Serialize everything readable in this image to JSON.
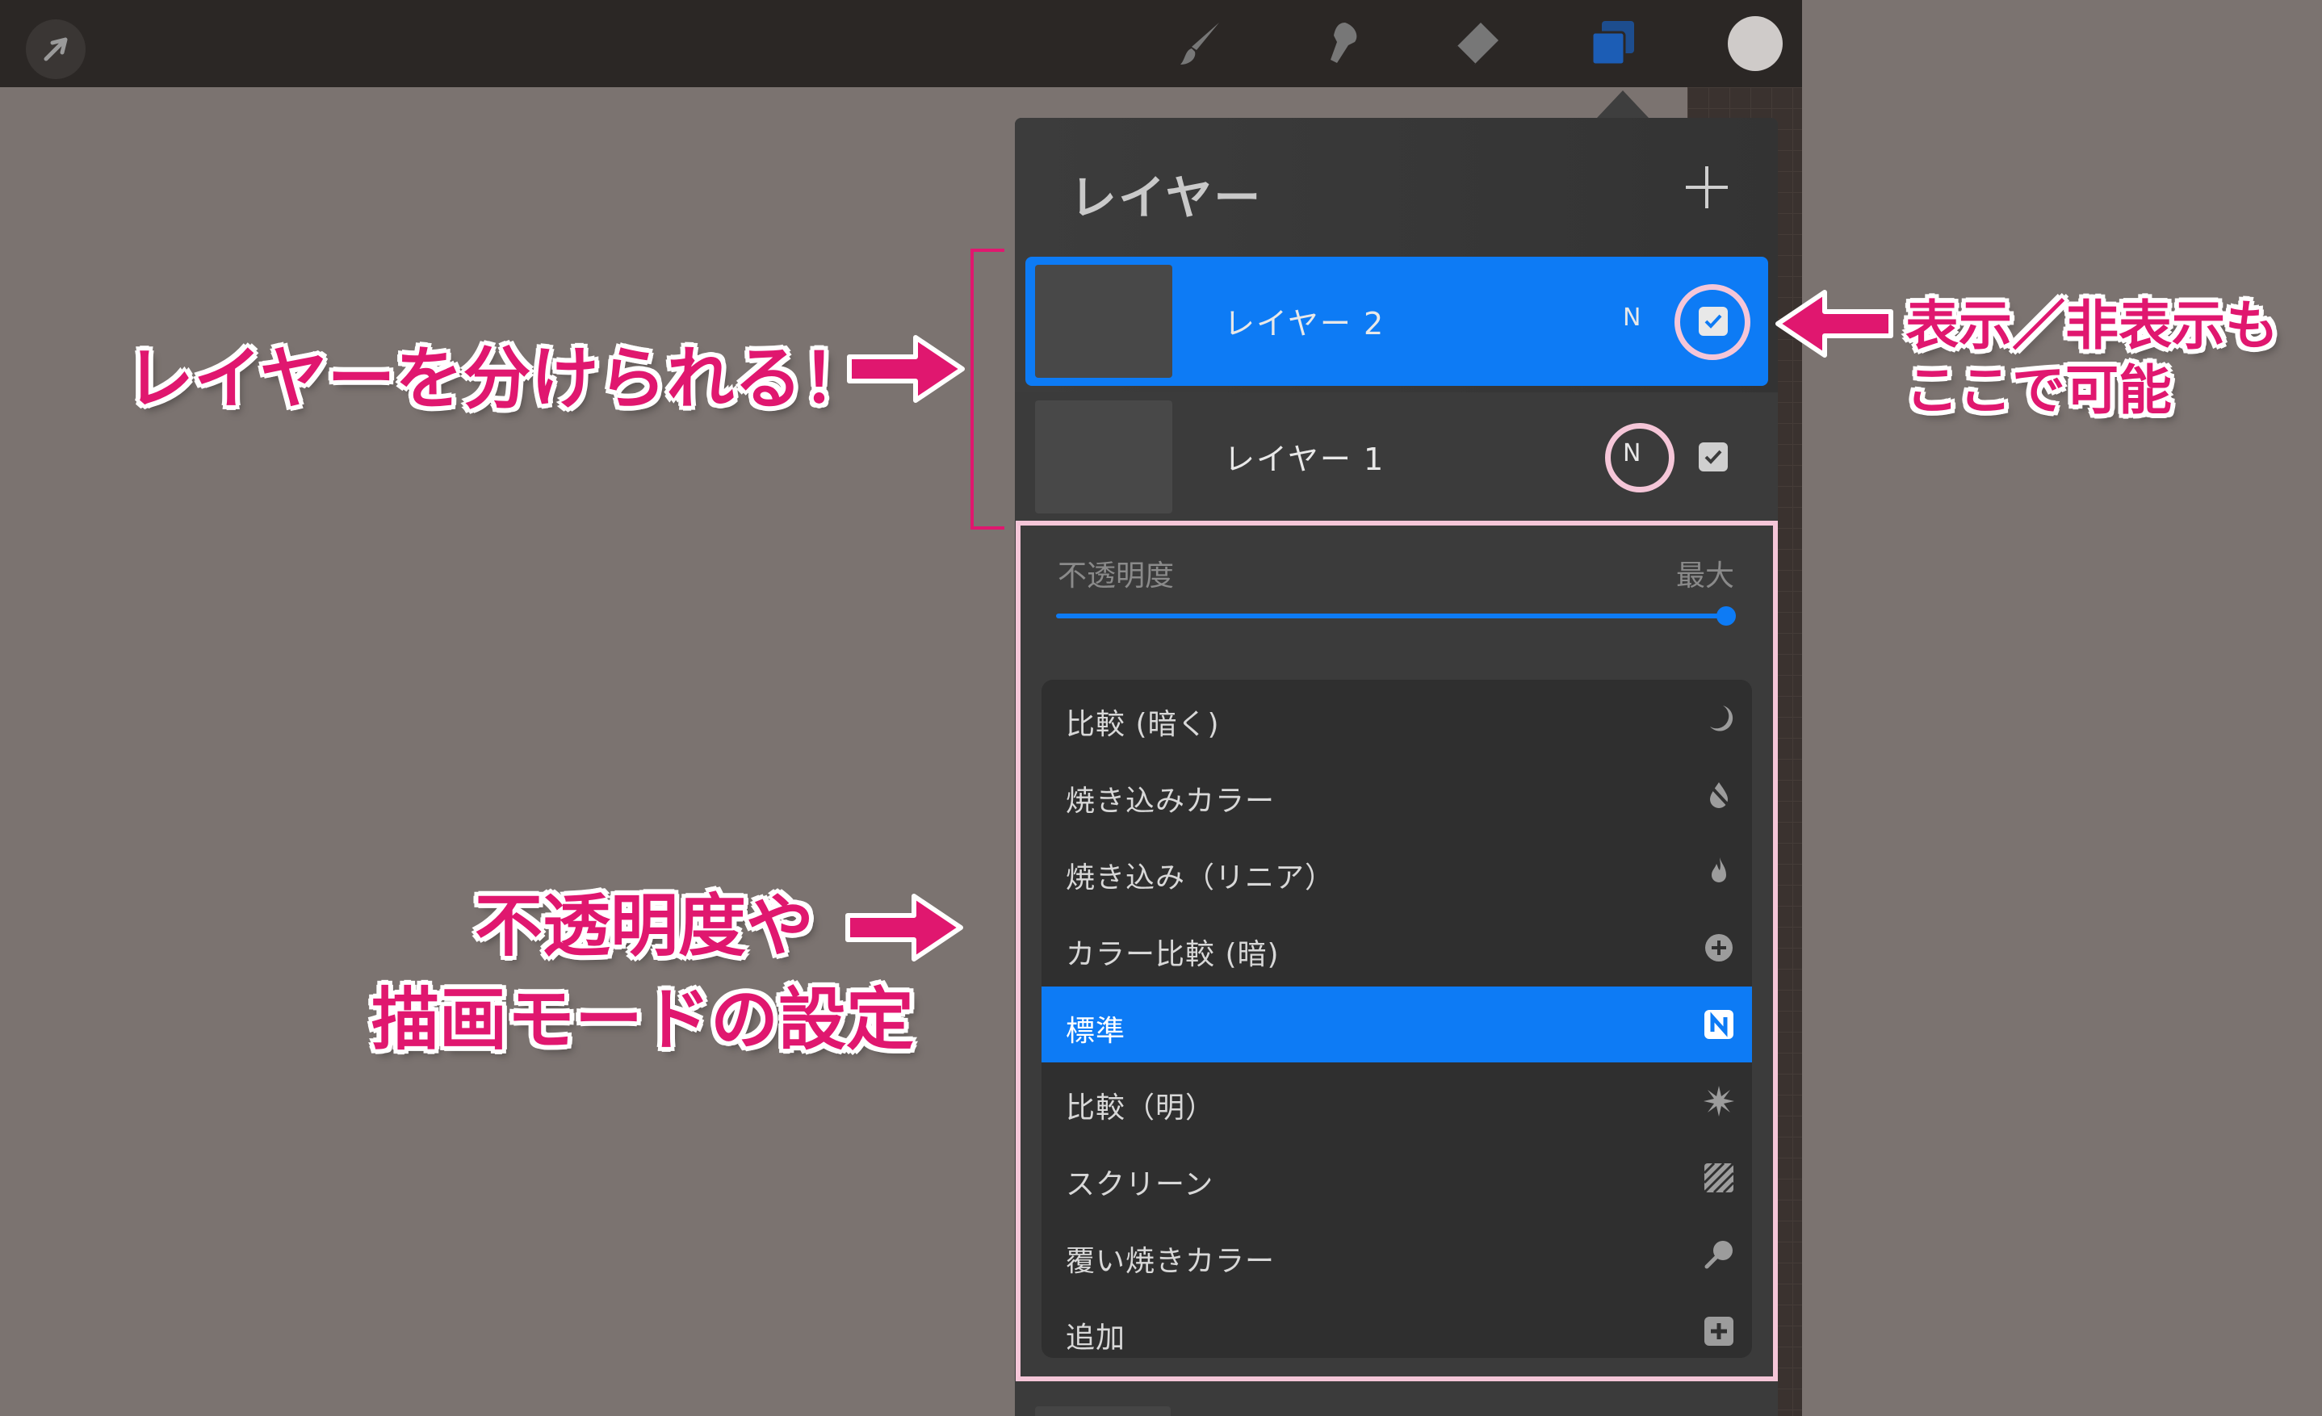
{
  "toolbar": {
    "tools": [
      "actions-icon",
      "brush-icon",
      "smudge-icon",
      "eraser-icon",
      "layers-icon",
      "color-icon"
    ]
  },
  "panel": {
    "title": "レイヤー",
    "layers": [
      {
        "name": "レイヤー 2",
        "blend": "N",
        "visible": true,
        "active": true
      },
      {
        "name": "レイヤー 1",
        "blend": "N",
        "visible": true,
        "active": false
      }
    ],
    "opacity_label": "不透明度",
    "opacity_value": "最大",
    "opacity_fraction": 1.0,
    "blend_modes": [
      {
        "label": "比較 (暗く)",
        "icon": "moon-icon"
      },
      {
        "label": "焼き込みカラー",
        "icon": "burn-drop-icon"
      },
      {
        "label": "焼き込み（リニア）",
        "icon": "flame-icon"
      },
      {
        "label": "カラー比較 (暗)",
        "icon": "plus-circle-icon"
      },
      {
        "label": "標準",
        "icon": "n-badge-icon",
        "selected": true
      },
      {
        "label": "比較（明）",
        "icon": "sunburst-icon"
      },
      {
        "label": "スクリーン",
        "icon": "hatch-icon"
      },
      {
        "label": "覆い焼きカラー",
        "icon": "dodge-icon"
      },
      {
        "label": "追加",
        "icon": "plus-square-icon"
      }
    ]
  },
  "annotations": {
    "layers_note": "レイヤーを分けられる！",
    "visibility_note_1": "表示／非表示も",
    "visibility_note_2": "ここで可能",
    "blend_note_1": "不透明度や",
    "blend_note_2": "描画モードの設定"
  },
  "colors": {
    "accent": "#0d7bf5",
    "annotation": "#e0176f",
    "highlight_ring": "#f5c6d8"
  }
}
